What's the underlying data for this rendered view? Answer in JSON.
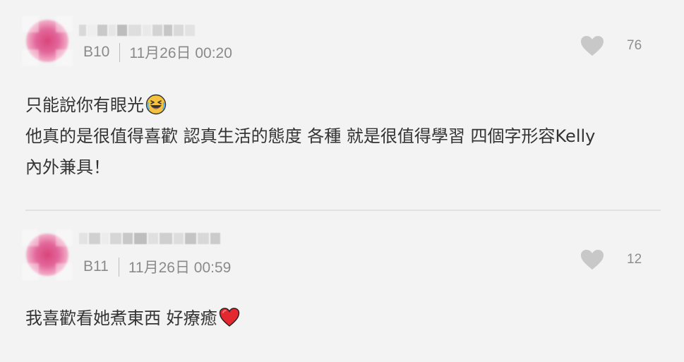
{
  "comments": [
    {
      "floor": "B10",
      "date": "11月26日 00:20",
      "likes": "76",
      "lines": [
        "只能說你有眼光",
        "他真的是很值得喜歡 認真生活的態度 各種 就是很值得學習 四個字形容Kelly",
        "內外兼具！"
      ],
      "emoji": "laughing-face-emoji"
    },
    {
      "floor": "B11",
      "date": "11月26日 00:59",
      "likes": "12",
      "lines": [
        "我喜歡看她煮東西 好療癒"
      ],
      "emoji": "red-heart-emoji"
    }
  ],
  "colors": {
    "background": "#f3f3f3",
    "text": "#333333",
    "meta": "#8a8a8a",
    "heart": "#c8c8c8",
    "avatar": "#d9457a",
    "divider": "#e1e1e1"
  }
}
